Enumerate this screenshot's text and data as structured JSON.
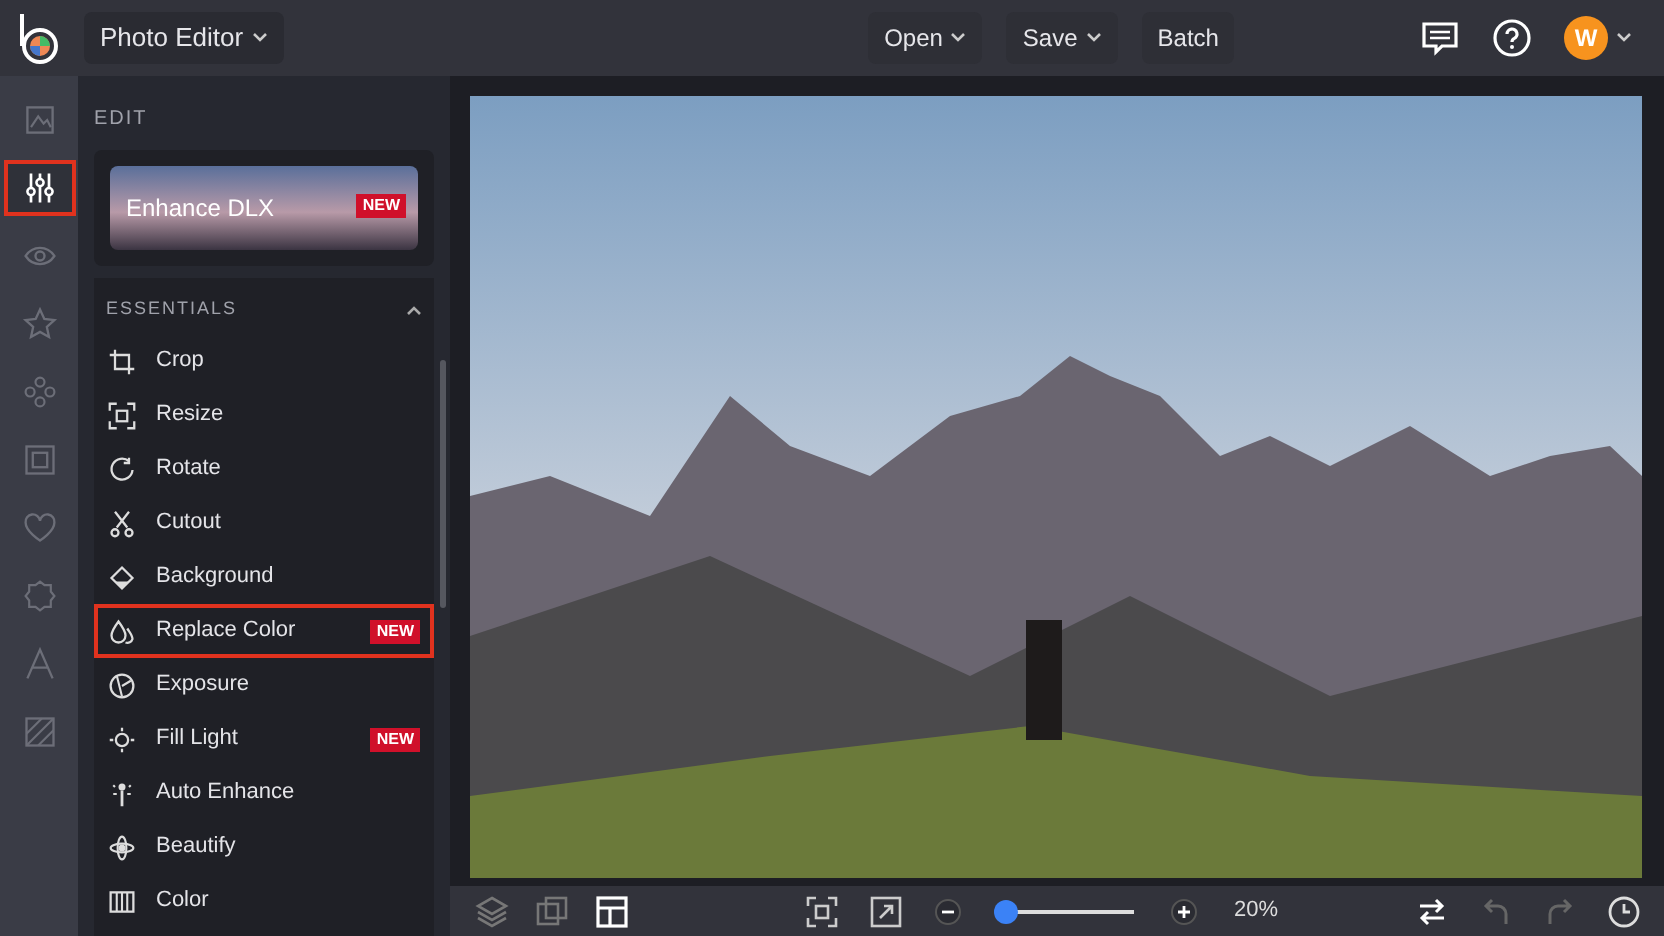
{
  "top_bar": {
    "app_menu": "Photo Editor",
    "menus": [
      "Open",
      "Save"
    ],
    "batch": "Batch",
    "avatar": "W"
  },
  "rail": {
    "items": [
      {
        "kind": "image",
        "selected": false,
        "highlighted": false
      },
      {
        "kind": "sliders",
        "selected": true,
        "highlighted": true
      },
      {
        "kind": "eye",
        "selected": false,
        "highlighted": false
      },
      {
        "kind": "star",
        "selected": false,
        "highlighted": false
      },
      {
        "kind": "circles",
        "selected": false,
        "highlighted": false
      },
      {
        "kind": "frame",
        "selected": false,
        "highlighted": false
      },
      {
        "kind": "heart",
        "selected": false,
        "highlighted": false
      },
      {
        "kind": "badge",
        "selected": false,
        "highlighted": false
      },
      {
        "kind": "text",
        "selected": false,
        "highlighted": false
      },
      {
        "kind": "texture",
        "selected": false,
        "highlighted": false
      }
    ]
  },
  "panel": {
    "heading": "EDIT",
    "promo": {
      "label": "Enhance DLX",
      "badge": "NEW"
    },
    "section": {
      "title": "ESSENTIALS",
      "expanded": true,
      "items": [
        {
          "kind": "crop",
          "label": "Crop",
          "highlighted": false
        },
        {
          "kind": "resize",
          "label": "Resize",
          "highlighted": false
        },
        {
          "kind": "rotate",
          "label": "Rotate",
          "highlighted": false
        },
        {
          "kind": "cutout",
          "label": "Cutout",
          "highlighted": false
        },
        {
          "kind": "background",
          "label": "Background",
          "highlighted": false
        },
        {
          "kind": "drops",
          "label": "Replace Color",
          "badge": "NEW",
          "highlighted": true
        },
        {
          "kind": "exposure",
          "label": "Exposure",
          "highlighted": false
        },
        {
          "kind": "light",
          "label": "Fill Light",
          "badge": "NEW",
          "highlighted": false
        },
        {
          "kind": "wand",
          "label": "Auto Enhance",
          "highlighted": false
        },
        {
          "kind": "flower",
          "label": "Beautify",
          "highlighted": false
        },
        {
          "kind": "color",
          "label": "Color",
          "highlighted": false
        }
      ]
    }
  },
  "bottom_bar": {
    "zoom": {
      "level": 0.06,
      "reading": "20%"
    }
  }
}
